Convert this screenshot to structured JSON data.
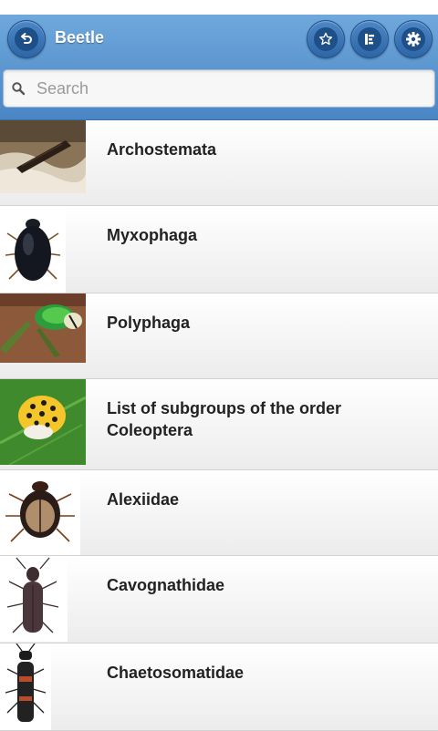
{
  "header": {
    "title": "Beetle",
    "back_icon": "back-arrow-icon",
    "favorite_icon": "star-icon",
    "toc_icon": "outline-icon",
    "settings_icon": "gear-icon",
    "accent": "#4a86c4"
  },
  "search": {
    "placeholder": "Search",
    "value": ""
  },
  "list": {
    "items": [
      {
        "label": "Archostemata",
        "thumb": "archostemata-photo"
      },
      {
        "label": "Myxophaga",
        "thumb": "myxophaga-photo"
      },
      {
        "label": "Polyphaga",
        "thumb": "polyphaga-photo"
      },
      {
        "label": "List of subgroups of the order Coleoptera",
        "thumb": "ladybird-photo"
      },
      {
        "label": "Alexiidae",
        "thumb": "alexiidae-photo"
      },
      {
        "label": "Cavognathidae",
        "thumb": "cavognathidae-photo"
      },
      {
        "label": "Chaetosomatidae",
        "thumb": "chaetosomatidae-photo"
      }
    ]
  }
}
